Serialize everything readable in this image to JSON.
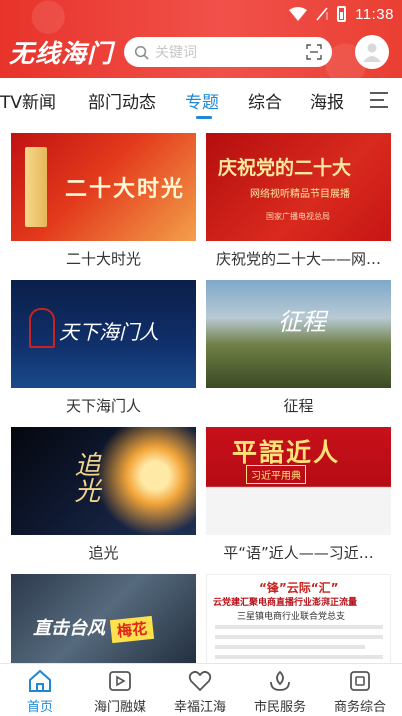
{
  "status_bar": {
    "time": "11:38"
  },
  "app": {
    "logo": "无线海门"
  },
  "search": {
    "placeholder": "关键词"
  },
  "tabs": [
    {
      "label": "TV新闻",
      "active": false
    },
    {
      "label": "部门动态",
      "active": false
    },
    {
      "label": "专题",
      "active": true
    },
    {
      "label": "综合",
      "active": false
    },
    {
      "label": "海报",
      "active": false
    }
  ],
  "cards": [
    {
      "caption": "二十大时光",
      "thumb_title": "二十大时光"
    },
    {
      "caption": "庆祝党的二十大——网…",
      "thumb_title": "庆祝党的二十大",
      "thumb_subtitle": "网络视听精品节目展播",
      "thumb_note": "国家广播电视总局"
    },
    {
      "caption": "天下海门人",
      "thumb_title": "天下海门人"
    },
    {
      "caption": "征程",
      "thumb_title": "征程"
    },
    {
      "caption": "追光",
      "thumb_title": "追光"
    },
    {
      "caption": "平“语”近人——习近…",
      "thumb_title": "平語近人",
      "thumb_subtitle": "习近平用典"
    },
    {
      "caption": "",
      "thumb_title": "直击台风",
      "thumb_badge": "梅花"
    },
    {
      "caption": "",
      "thumb_title": "“锋”云际“汇”",
      "thumb_subtitle": "云党建汇聚电商直播行业澎湃正流量",
      "thumb_note": "三星镇电商行业联合党总支"
    }
  ],
  "bottom_nav": [
    {
      "label": "首页",
      "icon": "home-icon",
      "active": true
    },
    {
      "label": "海门融媒",
      "icon": "media-play-icon",
      "active": false
    },
    {
      "label": "幸福江海",
      "icon": "heart-icon",
      "active": false
    },
    {
      "label": "市民服务",
      "icon": "service-icon",
      "active": false
    },
    {
      "label": "商务综合",
      "icon": "business-icon",
      "active": false
    }
  ],
  "colors": {
    "brand_red": "#e8332a",
    "accent_blue": "#1f88d6"
  }
}
